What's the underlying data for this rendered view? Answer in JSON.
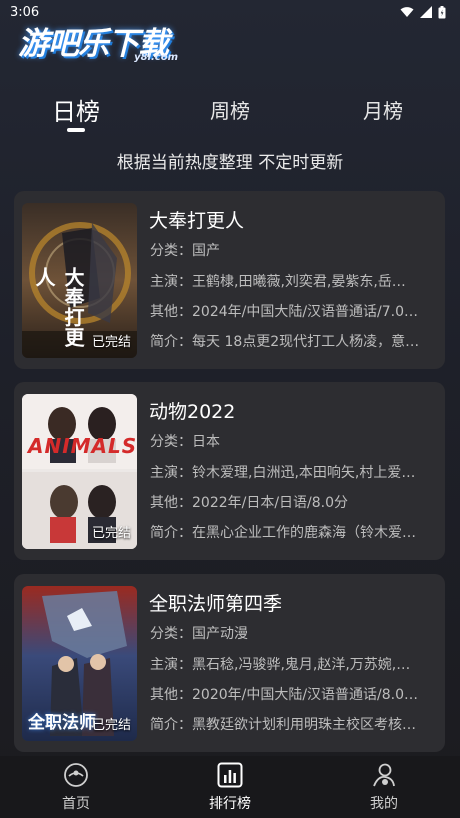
{
  "status_bar": {
    "time": "3:06"
  },
  "logo": {
    "main": "游吧乐下载",
    "sub": "y8l.com"
  },
  "tabs": [
    {
      "label": "日榜",
      "active": true
    },
    {
      "label": "周榜",
      "active": false
    },
    {
      "label": "月榜",
      "active": false
    }
  ],
  "subtitle": "根据当前热度整理 不定时更新",
  "items": [
    {
      "title": "大奉打更人",
      "category": "分类：国产",
      "cast": "主演：王鹤棣,田曦薇,刘奕君,晏紫东,岳…",
      "other": "其他：2024年/中国大陆/汉语普通话/7.0…",
      "intro": "简介：每天 18点更2现代打工人杨凌，意…",
      "status": "已完结",
      "poster_text": "大奉打更人",
      "poster_colors": [
        "#4a3a2a",
        "#8b6a4a"
      ]
    },
    {
      "title": "动物2022",
      "category": "分类：日本",
      "cast": "主演：铃木爱理,白洲迅,本田响矢,村上爱…",
      "other": "其他：2022年/日本/日语/8.0分",
      "intro": "简介：在黑心企业工作的鹿森海（铃木爱…",
      "status": "已完结",
      "poster_text": "ANIMALS",
      "poster_colors": [
        "#ece8e6",
        "#d9d2cf"
      ]
    },
    {
      "title": "全职法师第四季",
      "category": "分类：国产动漫",
      "cast": "主演：黑石稔,冯骏骅,鬼月,赵洋,万苏婉,…",
      "other": "其他：2020年/中国大陆/汉语普通话/8.0…",
      "intro": "简介：黑教廷欲计划利用明珠主校区考核…",
      "status": "已完结",
      "poster_text": "全职法师",
      "poster_colors": [
        "#2b4a7a",
        "#9a3a2a"
      ]
    }
  ],
  "bottom_nav": [
    {
      "label": "首页",
      "icon": "home-icon",
      "active": false
    },
    {
      "label": "排行榜",
      "icon": "ranking-icon",
      "active": true
    },
    {
      "label": "我的",
      "icon": "profile-icon",
      "active": false
    }
  ]
}
